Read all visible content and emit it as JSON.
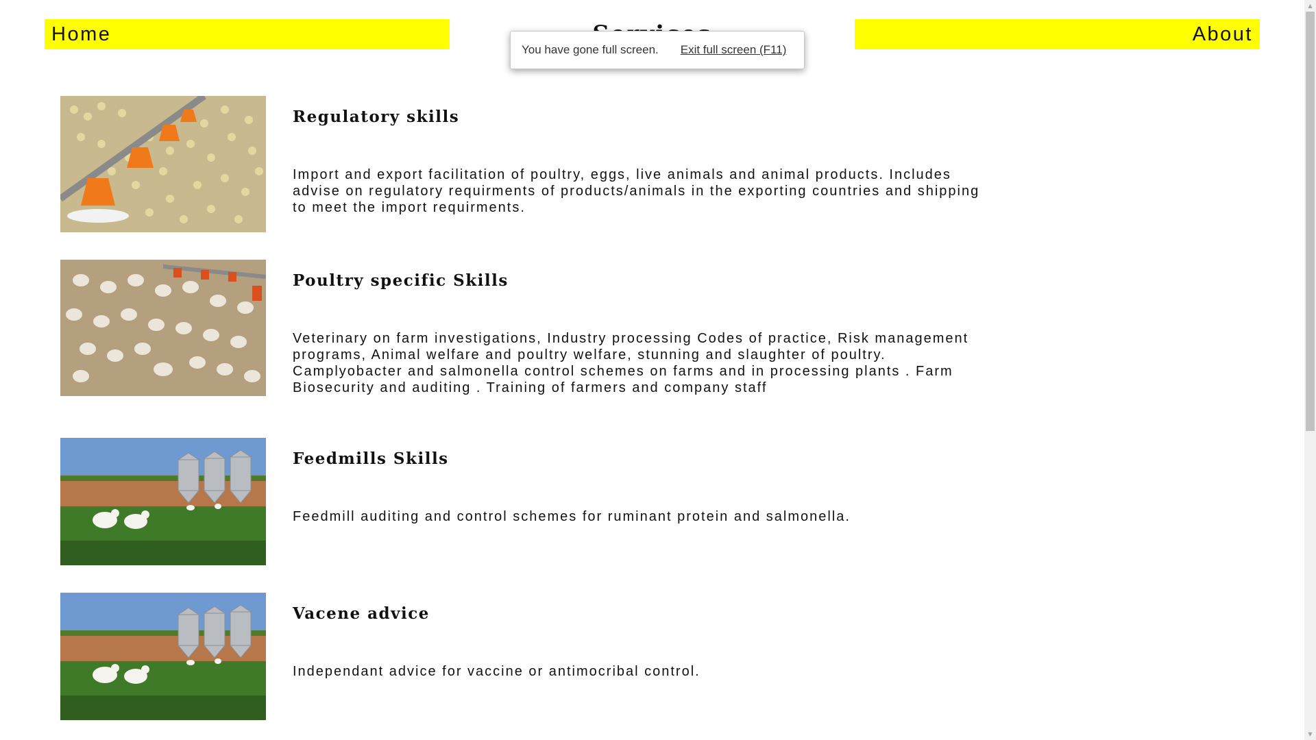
{
  "nav": {
    "home": "Home",
    "services": "Services",
    "about": "About"
  },
  "fullscreen_notice": {
    "message": "You have gone full screen.",
    "exit_link": "Exit full screen (F11)"
  },
  "services": [
    {
      "title": "Regulatory skills",
      "description": "Import and export facilitation of poultry, eggs, live animals and animal products. Includes advise on regulatory requirments of products/animals in the exporting countries and shipping to meet the import requirments.",
      "image": "chicks-feeder-image"
    },
    {
      "title": "Poultry specific Skills",
      "description": "Veterinary on farm investigations, Industry processing Codes of practice, Risk management programs, Animal welfare and poultry welfare, stunning and slaughter of poultry. Camplyobacter and salmonella control schemes on farms and in processing plants . Farm Biosecurity and auditing . Training of farmers and company staff",
      "image": "broiler-house-image"
    },
    {
      "title": "Feedmills Skills",
      "description": "Feedmill auditing and control schemes for ruminant protein and salmonella.",
      "image": "feed-silos-image"
    },
    {
      "title": "Vacene advice",
      "description": "Independant advice for vaccine or antimocribal control.",
      "image": "feed-silos-image"
    }
  ],
  "colors": {
    "nav_background": "#ffff00",
    "page_background": "#ffffff",
    "text": "#111111"
  }
}
